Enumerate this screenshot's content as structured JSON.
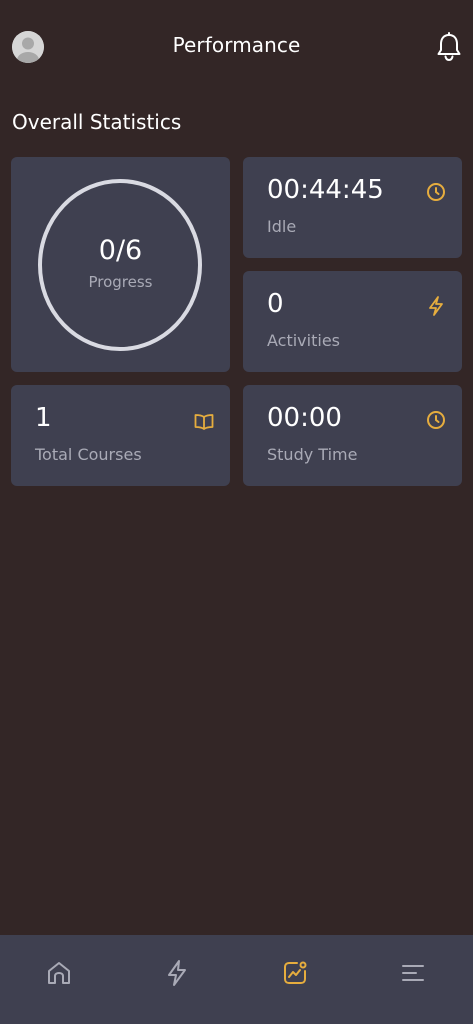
{
  "header": {
    "title": "Performance"
  },
  "section": {
    "title": "Overall Statistics"
  },
  "stats": {
    "progress": {
      "value": "0/6",
      "label": "Progress"
    },
    "idle": {
      "value": "00:44:45",
      "label": "Idle",
      "icon": "clock-icon"
    },
    "activities": {
      "value": "0",
      "label": "Activities",
      "icon": "lightning-icon"
    },
    "total_courses": {
      "value": "1",
      "label": "Total Courses",
      "icon": "book-icon"
    },
    "study_time": {
      "value": "00:00",
      "label": "Study Time",
      "icon": "clock-icon"
    }
  },
  "nav": {
    "items": [
      {
        "icon": "home-icon",
        "active": false
      },
      {
        "icon": "lightning-icon",
        "active": false
      },
      {
        "icon": "performance-chart-icon",
        "active": true
      },
      {
        "icon": "menu-icon",
        "active": false
      }
    ]
  },
  "colors": {
    "background": "#332626",
    "card": "#3f4050",
    "accent": "#e6ad3e",
    "muted_text": "#a9aab6",
    "ring": "#d9dae2"
  }
}
